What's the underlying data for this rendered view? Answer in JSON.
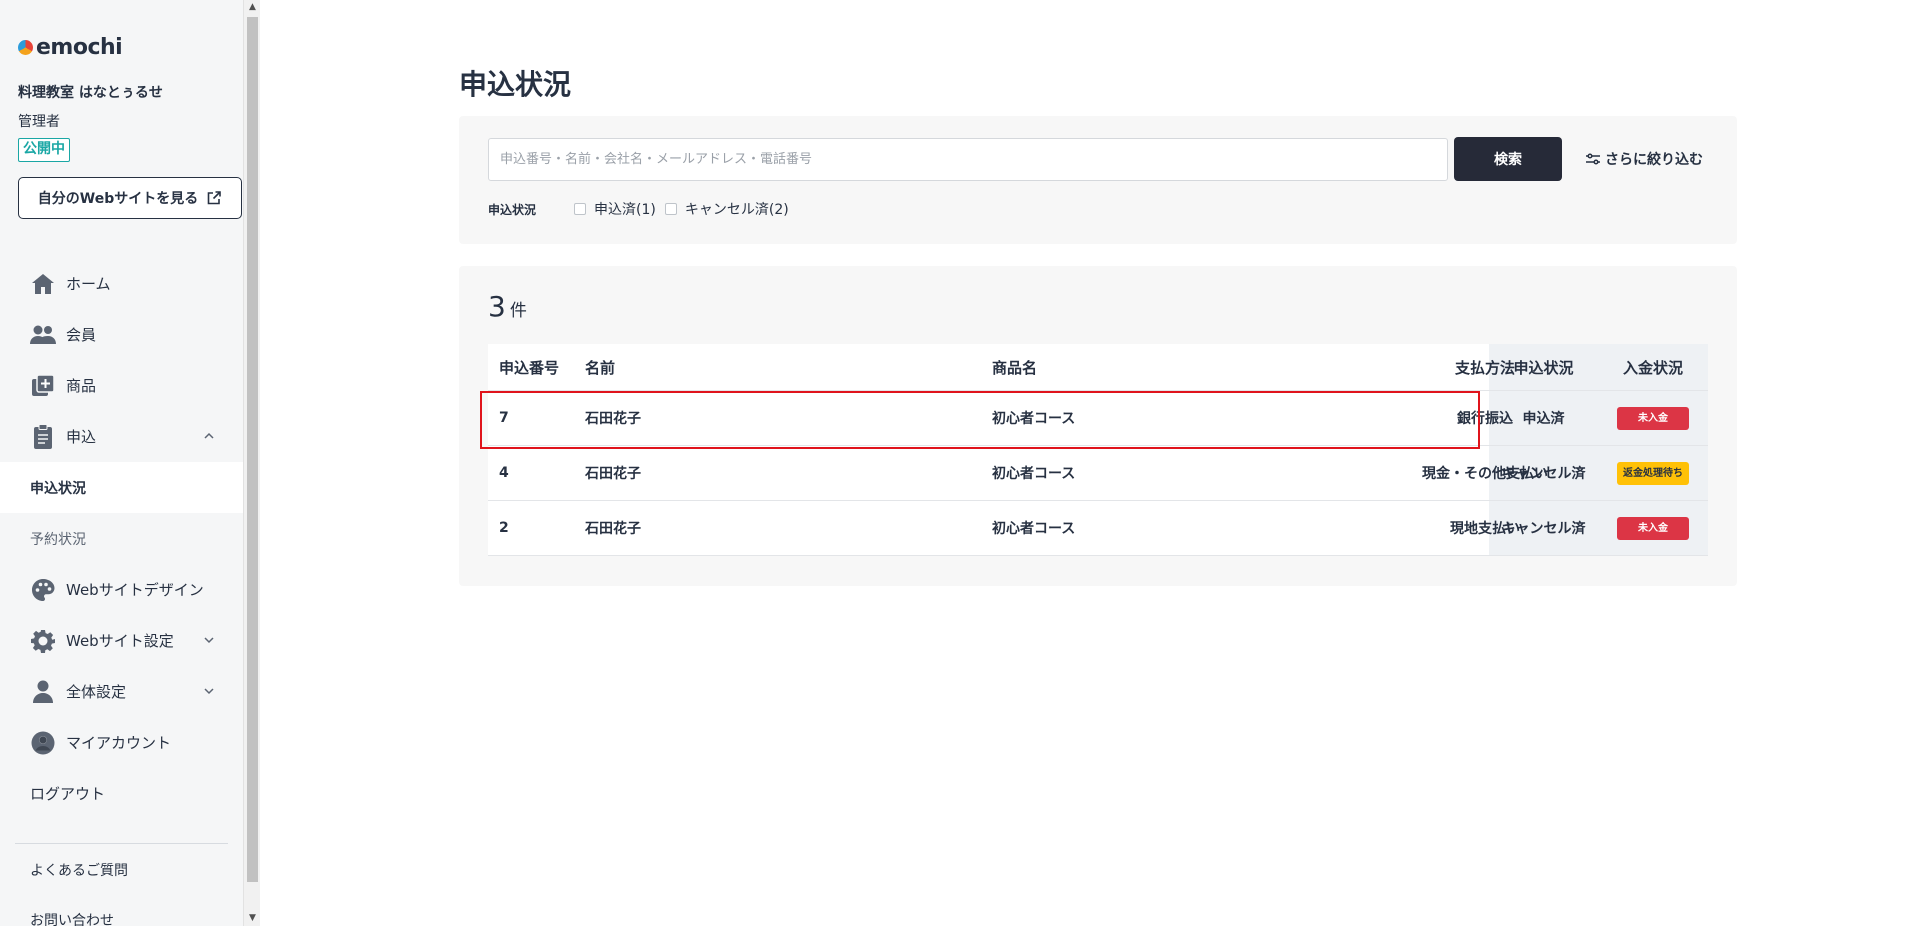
{
  "sidebar": {
    "logo_text": "emochi",
    "org_name": "料理教室 はなとぅるせ",
    "role": "管理者",
    "status": "公開中",
    "site_button": "自分のWebサイトを見る",
    "nav": {
      "home": "ホーム",
      "members": "会員",
      "products": "商品",
      "applications": "申込",
      "sub_application_status": "申込状況",
      "sub_reservation_status": "予約状況",
      "web_design": "Webサイトデザイン",
      "web_settings": "Webサイト設定",
      "global_settings": "全体設定",
      "my_account": "マイアカウント",
      "logout": "ログアウト"
    },
    "faq": "よくあるご質問",
    "contact": "お問い合わせ"
  },
  "main": {
    "title": "申込状況",
    "search": {
      "placeholder": "申込番号・名前・会社名・メールアドレス・電話番号",
      "button": "検索",
      "filter_link": "さらに絞り込む",
      "filter_label": "申込状況",
      "options": [
        "申込済(1)",
        "キャンセル済(2)"
      ]
    },
    "results": {
      "count": "3",
      "unit": "件",
      "headers": {
        "id": "申込番号",
        "name": "名前",
        "product": "商品名",
        "payment": "支払方法",
        "app_status": "申込状況",
        "deposit_status": "入金状況"
      },
      "rows": [
        {
          "id": "7",
          "name": "石田花子",
          "product": "初心者コース",
          "payment": "銀行振込",
          "app_status": "申込済",
          "deposit_status": "未入金",
          "deposit_color": "#dc3545"
        },
        {
          "id": "4",
          "name": "石田花子",
          "product": "初心者コース",
          "payment": "現金・その他支払い",
          "app_status": "キャンセル済",
          "deposit_status": "返金処理待ち",
          "deposit_color": "#ffc107"
        },
        {
          "id": "2",
          "name": "石田花子",
          "product": "初心者コース",
          "payment": "現地支払い",
          "app_status": "キャンセル済",
          "deposit_status": "未入金",
          "deposit_color": "#dc3545"
        }
      ]
    }
  },
  "colors": {
    "accent_teal": "#1aa7a5",
    "dark_button": "#262a38",
    "badge_red": "#dc3545",
    "badge_yellow": "#ffc107",
    "highlight_red": "#e0141c"
  }
}
